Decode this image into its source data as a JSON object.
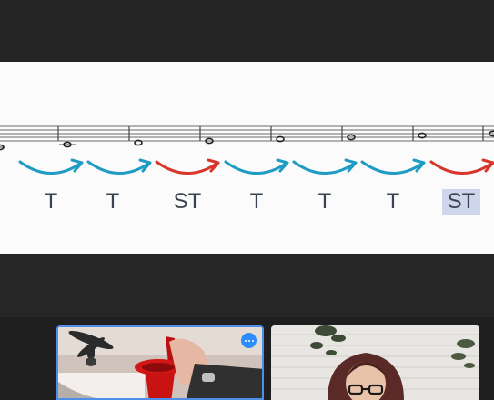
{
  "meeting": {
    "shared_content": {
      "scale_steps": [
        {
          "label": "T",
          "type": "tone"
        },
        {
          "label": "T",
          "type": "tone"
        },
        {
          "label": "ST",
          "type": "semitone"
        },
        {
          "label": "T",
          "type": "tone"
        },
        {
          "label": "T",
          "type": "tone"
        },
        {
          "label": "T",
          "type": "tone"
        },
        {
          "label": "ST",
          "type": "semitone",
          "highlighted": true
        }
      ],
      "colors": {
        "tone": "#1f9bc4",
        "semitone": "#d9362b",
        "staff": "#555555",
        "text": "#3a4450",
        "highlight": "#cdd6ea"
      }
    },
    "participants": [
      {
        "id": "participant-1",
        "active_speaker": true,
        "accent": "#4d8fe8"
      },
      {
        "id": "participant-2",
        "active_speaker": false
      }
    ]
  }
}
